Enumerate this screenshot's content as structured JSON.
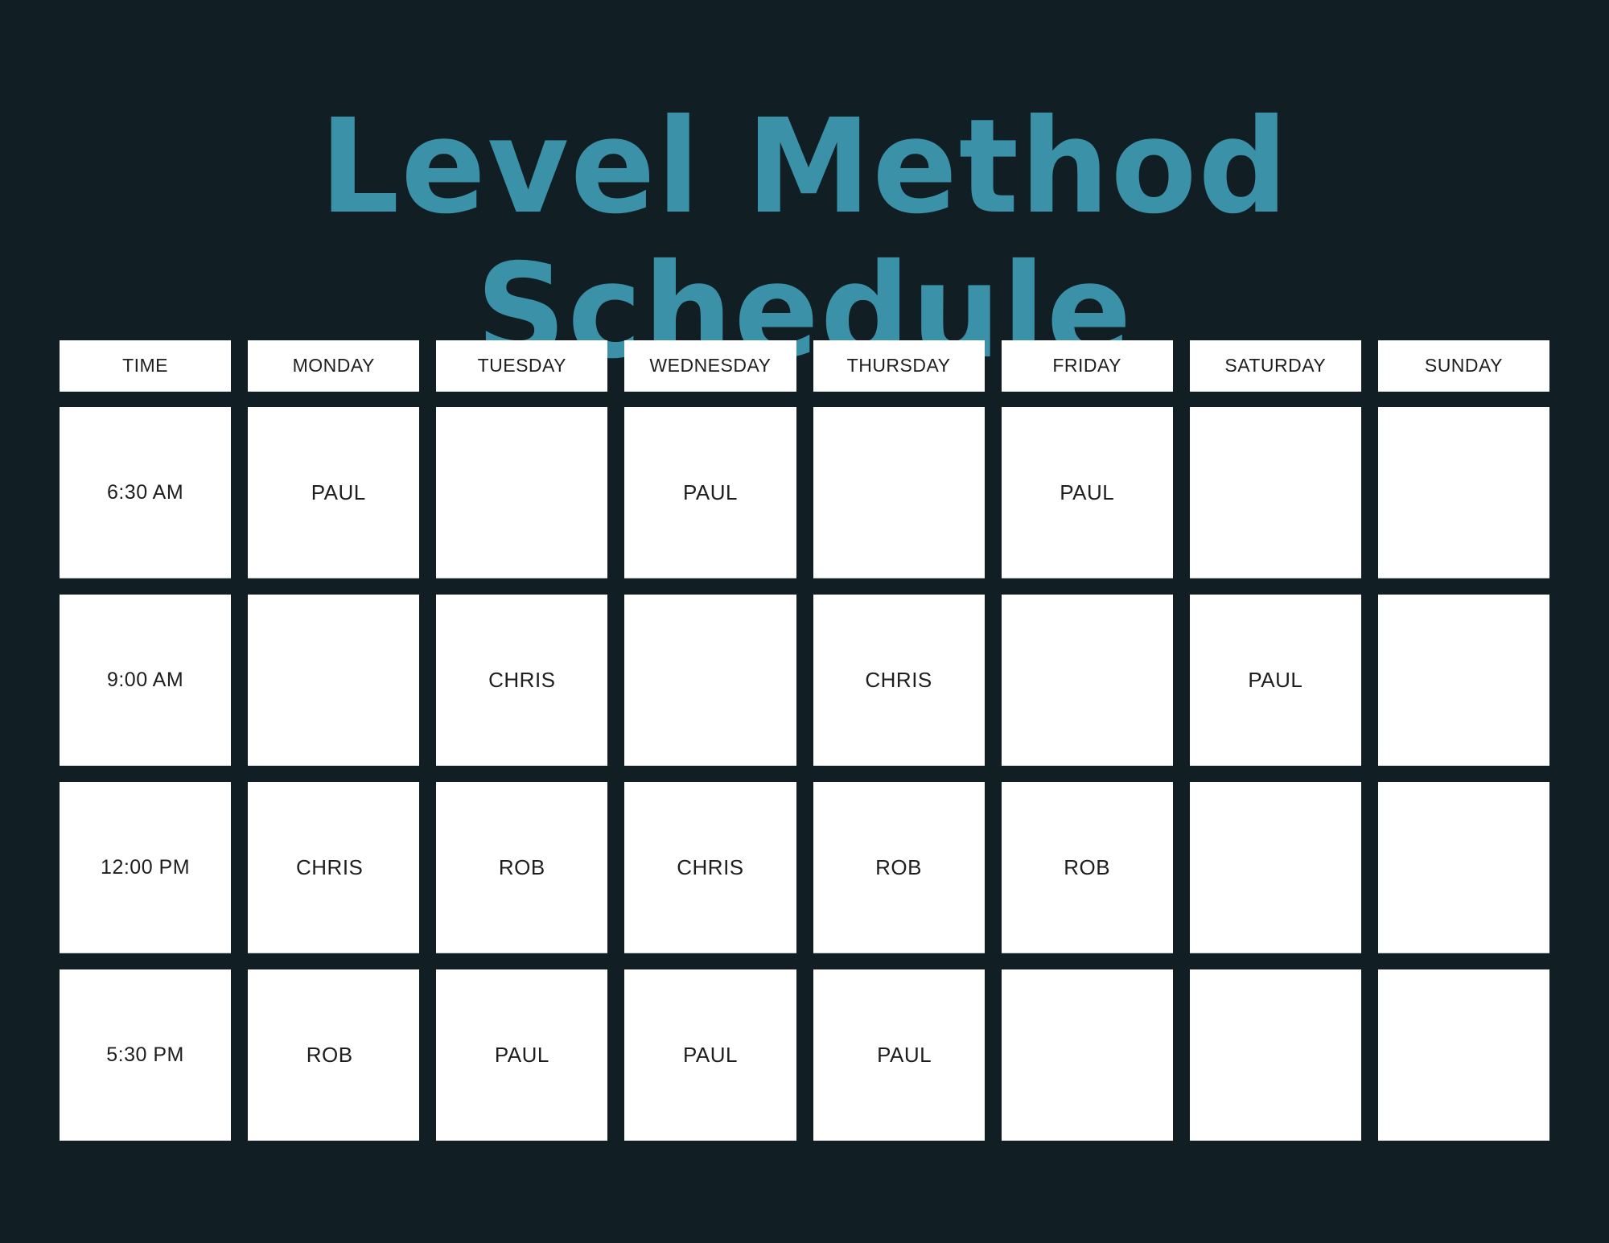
{
  "title": "Level Method Schedule",
  "colors": {
    "background": "#111e24",
    "title": "#3a91a8",
    "cell": "#ffffff",
    "text": "#1e1e1e"
  },
  "schedule": {
    "headers": [
      "TIME",
      "MONDAY",
      "TUESDAY",
      "WEDNESDAY",
      "THURSDAY",
      "FRIDAY",
      "SATURDAY",
      "SUNDAY"
    ],
    "rows": [
      {
        "time": "6:30 AM",
        "slots": [
          "PAUL",
          "",
          "PAUL",
          "",
          "PAUL",
          "",
          ""
        ]
      },
      {
        "time": "9:00 AM",
        "slots": [
          "",
          "CHRIS",
          "",
          "CHRIS",
          "",
          "PAUL",
          ""
        ]
      },
      {
        "time": "12:00 PM",
        "slots": [
          "CHRIS",
          "ROB",
          "CHRIS",
          "ROB",
          "ROB",
          "",
          ""
        ]
      },
      {
        "time": "5:30 PM",
        "slots": [
          "ROB",
          "PAUL",
          "PAUL",
          "PAUL",
          "",
          "",
          ""
        ]
      }
    ]
  }
}
